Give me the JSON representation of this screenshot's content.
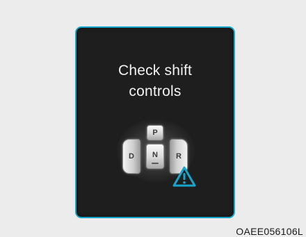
{
  "display": {
    "message_line1": "Check shift",
    "message_line2": "controls",
    "border_color": "#16a6cc"
  },
  "shifter": {
    "keys": {
      "p": "P",
      "n": "N",
      "d": "D",
      "r": "R"
    },
    "warning_icon": "warning-triangle-icon",
    "warning_color": "#16a6cc"
  },
  "caption": "OAEE056106L"
}
